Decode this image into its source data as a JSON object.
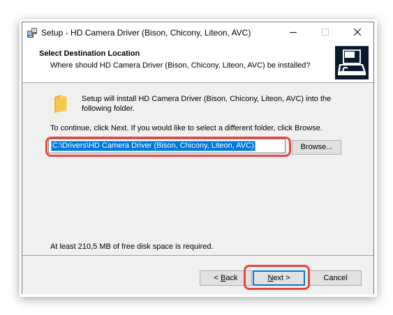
{
  "window": {
    "title": "Setup - HD Camera Driver (Bison, Chicony, Liteon, AVC)"
  },
  "header": {
    "title": "Select Destination Location",
    "subtitle": "Where should HD Camera Driver (Bison, Chicony, Liteon, AVC) be installed?"
  },
  "content": {
    "install_line1": "Setup will install HD Camera Driver (Bison, Chicony, Liteon, AVC) into the",
    "install_line2": "following folder.",
    "continue_text": "To continue, click Next. If you would like to select a different folder, click Browse.",
    "path_value": "C:\\Drivers\\HD Camera Driver (Bison, Chicony, Liteon, AVC)",
    "browse_label": "Browse...",
    "disk_space": "At least 210,5 MB of free disk space is required."
  },
  "footer": {
    "back_prefix": "< ",
    "back_accel": "B",
    "back_rest": "ack",
    "next_accel": "N",
    "next_rest": "ext >",
    "cancel_label": "Cancel"
  },
  "colors": {
    "highlight": "#e8473f",
    "selection": "#0078d7",
    "panel": "#f0f0f0"
  },
  "icons": [
    "setup-app-icon",
    "minimize-icon",
    "maximize-icon",
    "close-icon",
    "wizard-computer-icon",
    "folder-icon"
  ]
}
